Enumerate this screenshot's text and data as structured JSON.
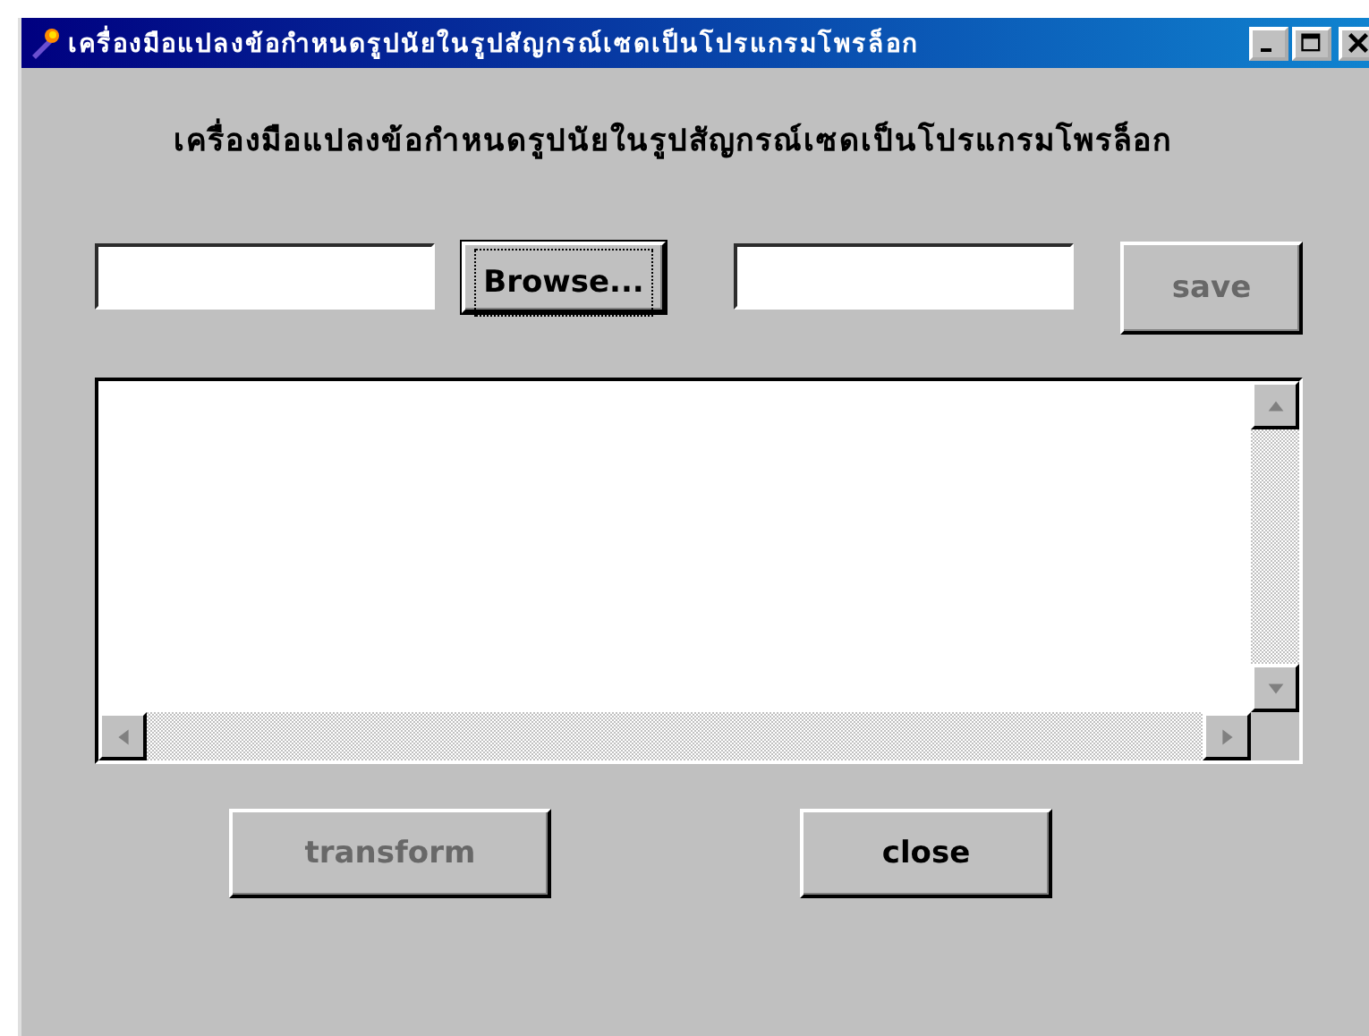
{
  "window": {
    "title": "เครื่องมือแปลงข้อกำหนดรูปนัยในรูปสัญกรณ์เซดเป็นโปรแกรมโพรล็อก"
  },
  "heading": "เครื่องมือแปลงข้อกำหนดรูปนัยในรูปสัญกรณ์เซดเป็นโปรแกรมโพรล็อก",
  "file_row": [
    {
      "kind": "field"
    },
    {
      "kind": "button",
      "label": "Browse...",
      "focused": true,
      "disabled": false
    },
    {
      "kind": "field"
    },
    {
      "kind": "button",
      "label": "save",
      "focused": false,
      "disabled": true
    }
  ],
  "action_buttons": [
    {
      "label": "transform",
      "disabled": true
    },
    {
      "label": "close",
      "disabled": false
    }
  ]
}
